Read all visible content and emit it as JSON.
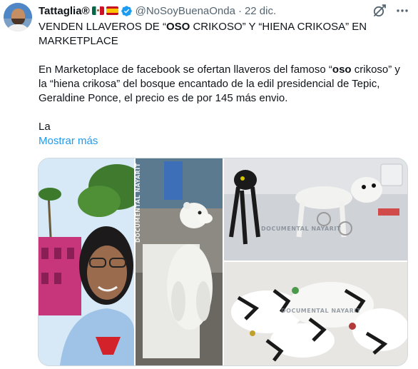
{
  "author": {
    "name": "Tattaglia®",
    "handle": "@NoSoyBuenaOnda",
    "separator": "·",
    "date": "22 dic.",
    "flags": [
      "mexico-flag",
      "spain-flag"
    ],
    "verified": true
  },
  "post": {
    "p1_part1": "VENDEN LLAVEROS DE “",
    "p1_bold": "OSO",
    "p1_part2": " CRIKOSO” Y “HIENA CRIKOSA” EN MARKETPLACE",
    "p2_part1": "En Marketoplace de facebook se ofertan llaveros del famoso “",
    "p2_bold": "oso",
    "p2_part2": " crikoso” y la “hiena crikosa” del bosque encantado de la edil presidencial de Tepic, Geraldine Ponce, el precio es de por 145 más envio.",
    "p3": "La",
    "show_more": "Mostrar más"
  },
  "media": {
    "watermark": "DOCUMENTAL NAYARIT",
    "images": [
      "selfie-photo",
      "bear-statue-photo",
      "keychains-photo",
      "keychain-pile-photo"
    ]
  },
  "icons": {
    "grok": "grok-icon",
    "more": "more-options-icon"
  },
  "colors": {
    "link": "#1d9bf0",
    "secondary_text": "#536471",
    "verified": "#1d9bf0"
  }
}
